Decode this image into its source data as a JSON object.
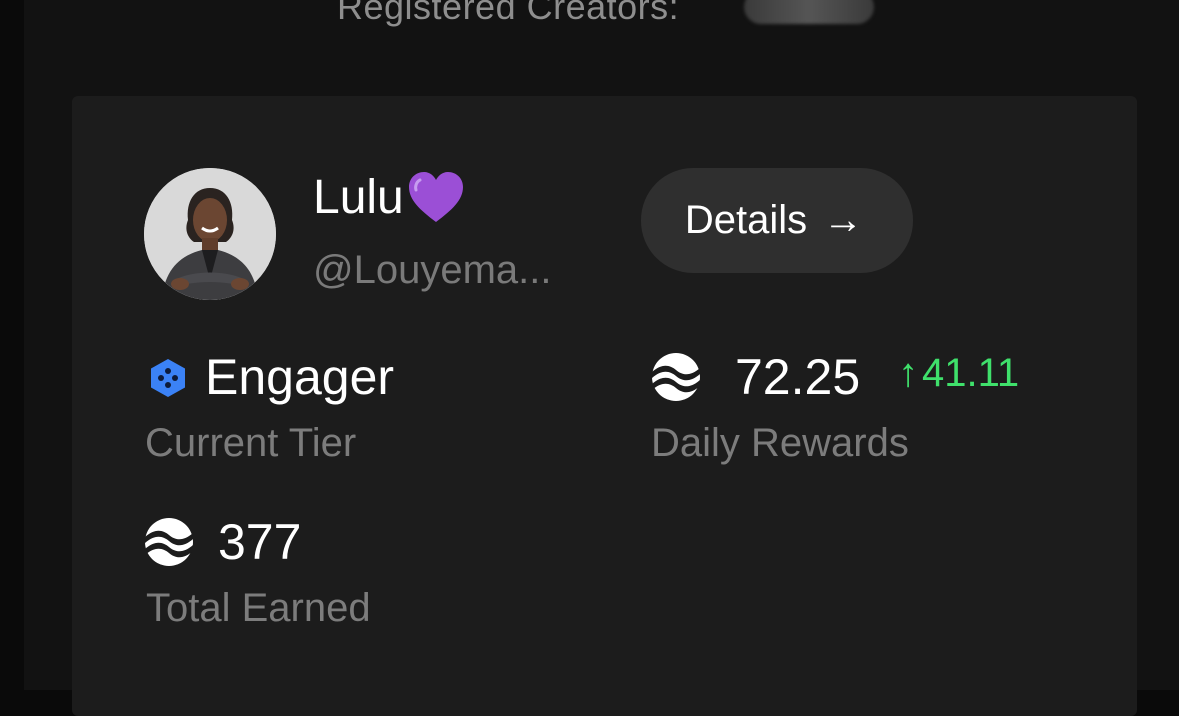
{
  "header": {
    "registered_creators_label": "Registered Creators:"
  },
  "profile": {
    "display_name": "Lulu",
    "handle": "@Louyema..."
  },
  "details_button": {
    "label": "Details",
    "arrow": "→"
  },
  "stats": {
    "tier": {
      "value": "Engager",
      "label": "Current Tier",
      "icon": "hexagon-tier-icon"
    },
    "daily_rewards": {
      "value": "72.25",
      "change": "41.11",
      "change_arrow": "↑",
      "label": "Daily Rewards",
      "icon": "wave-token-icon"
    },
    "total_earned": {
      "value": "377",
      "label": "Total Earned",
      "icon": "wave-token-icon"
    }
  },
  "colors": {
    "background": "#121212",
    "card": "#1c1c1c",
    "button": "#2f2f2f",
    "muted_text": "#7c7c7c",
    "positive": "#3fe06b",
    "tier_blue": "#3b82f6",
    "heart_purple": "#9b4fd6"
  }
}
